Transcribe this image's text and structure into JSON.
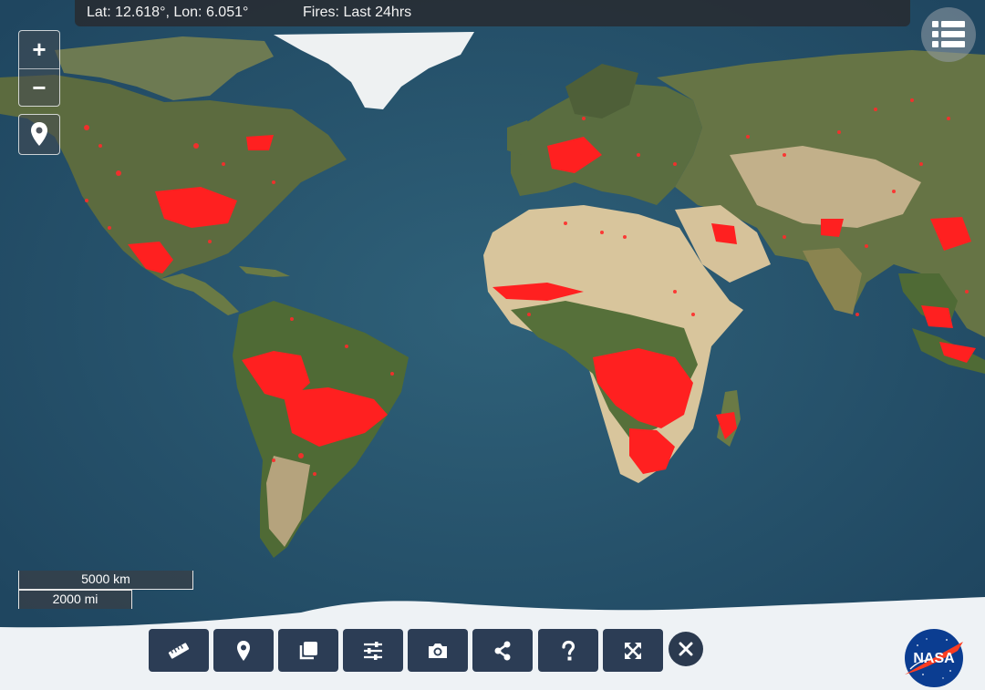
{
  "status": {
    "coordinates": "Lat: 12.618°, Lon: 6.051°",
    "fires": "Fires: Last 24hrs"
  },
  "zoom": {
    "in_label": "+",
    "out_label": "−"
  },
  "scale": {
    "km_label": "5000 km",
    "mi_label": "2000 mi"
  },
  "toolbar": {
    "items": [
      {
        "name": "measure",
        "icon": "ruler-icon"
      },
      {
        "name": "location",
        "icon": "map-marker-icon"
      },
      {
        "name": "layers-copy",
        "icon": "copy-icon"
      },
      {
        "name": "settings",
        "icon": "sliders-icon"
      },
      {
        "name": "snapshot",
        "icon": "camera-icon"
      },
      {
        "name": "share",
        "icon": "share-icon"
      },
      {
        "name": "help",
        "icon": "question-icon"
      },
      {
        "name": "fullscreen",
        "icon": "expand-icon"
      }
    ],
    "close_icon": "close-icon"
  },
  "logo": {
    "text": "NASA"
  },
  "colors": {
    "ocean": "#2d5a72",
    "fire": "#ff2020",
    "toolbar_bg": "#2c3d55",
    "statusbar_bg": "#2a2c30"
  }
}
